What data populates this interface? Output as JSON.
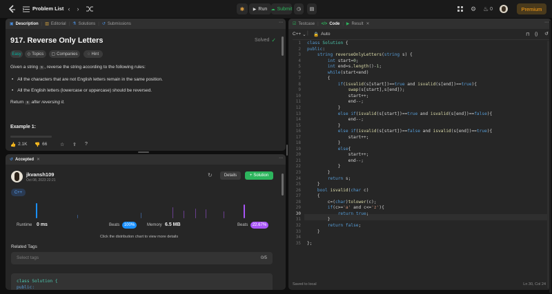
{
  "topbar": {
    "title": "Problem List",
    "run_label": "Run",
    "submit_label": "Submit",
    "streak": "0",
    "premium_label": "Premium"
  },
  "left": {
    "tabs": [
      {
        "label": "Description"
      },
      {
        "label": "Editorial"
      },
      {
        "label": "Solutions"
      },
      {
        "label": "Submissions"
      }
    ],
    "problem_title": "917. Reverse Only Letters",
    "solved_label": "Solved",
    "tags": {
      "difficulty": "Easy",
      "topics": "Topics",
      "companies": "Companies",
      "hint": "Hint"
    },
    "desc": {
      "intro_1": "Given a string ",
      "intro_code": "s",
      "intro_2": ", reverse the string according to the following rules:",
      "rule_1": "All the characters that are not English letters remain in the same position.",
      "rule_2": "All the English letters (lowercase or uppercase) should be reversed.",
      "ret_1": "Return ",
      "ret_code": "s",
      "ret_2": " after reversing it.",
      "example": "Example 1:"
    },
    "likes": "2.1K",
    "dislikes": "66"
  },
  "accepted": {
    "tab_label": "Accepted",
    "username": "jkvansh109",
    "date": "Oct 08, 2023 22:21",
    "details_label": "Details",
    "solution_label": "Solution",
    "lang": "C++",
    "runtime_label": "Runtime",
    "runtime_value": "0 ms",
    "beats_label": "Beats",
    "runtime_beats": "100%",
    "memory_label": "Memory",
    "memory_value": "6.5 MB",
    "memory_beats": "22.67%",
    "hint": "Click the distribution chart to view more details",
    "related_tags": "Related Tags",
    "select_placeholder": "Select tags",
    "tag_count": "0/5",
    "preview_line_1": "class Solution {",
    "preview_line_2": "public:"
  },
  "right": {
    "tabs": [
      {
        "label": "Testcase"
      },
      {
        "label": "Code"
      },
      {
        "label": "Result"
      }
    ],
    "lang": "C++",
    "auto_label": "Auto",
    "status": "Saved to local",
    "cursor": "Ln 30, Col 24",
    "line_numbers": [
      "1",
      "2",
      "3",
      "4",
      "5",
      "6",
      "7",
      "8",
      "9",
      "10",
      "11",
      "12",
      "13",
      "14",
      "15",
      "16",
      "17",
      "18",
      "19",
      "20",
      "21",
      "22",
      "23",
      "24",
      "25",
      "26",
      "27",
      "28",
      "29",
      "30",
      "31",
      "32",
      "33",
      "34",
      "35"
    ]
  },
  "colors": {
    "bg": "#0f0f0f",
    "panel": "#262626",
    "accent_green": "#2db55d",
    "premium": "#ffa116",
    "easy": "#00b8a3",
    "beats_blue": "#1a90ff",
    "beats_purple": "#a855f7"
  }
}
